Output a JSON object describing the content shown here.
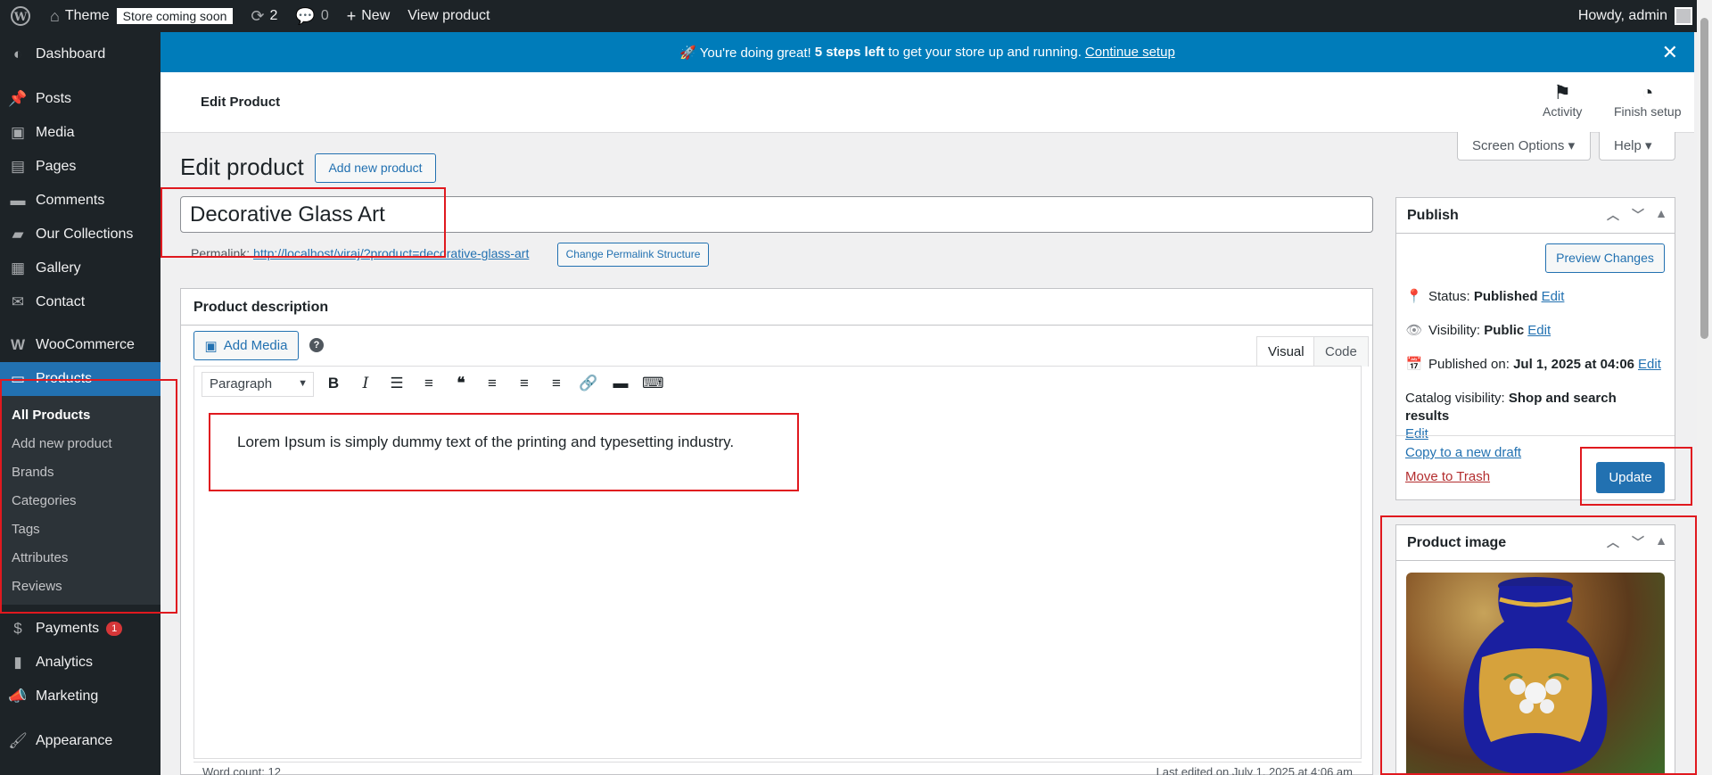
{
  "adminbar": {
    "site_name": "Theme",
    "store_badge": "Store coming soon",
    "updates_count": "2",
    "comments_count": "0",
    "new_label": "New",
    "view_product": "View product",
    "howdy": "Howdy, admin"
  },
  "sidebar": {
    "dashboard": "Dashboard",
    "posts": "Posts",
    "media": "Media",
    "pages": "Pages",
    "comments": "Comments",
    "collections": "Our Collections",
    "gallery": "Gallery",
    "contact": "Contact",
    "woocommerce": "WooCommerce",
    "products": "Products",
    "submenu": [
      "All Products",
      "Add new product",
      "Brands",
      "Categories",
      "Tags",
      "Attributes",
      "Reviews"
    ],
    "payments": "Payments",
    "payments_badge": "1",
    "analytics": "Analytics",
    "marketing": "Marketing",
    "appearance": "Appearance"
  },
  "notice": {
    "prefix": "🚀 You're doing great!",
    "bold": "5 steps left",
    "suffix": "to get your store up and running.",
    "link": "Continue setup"
  },
  "header": {
    "title": "Edit Product",
    "activity": "Activity",
    "finish_setup": "Finish setup",
    "screen_options": "Screen Options",
    "help": "Help"
  },
  "main": {
    "heading": "Edit product",
    "add_new": "Add new product",
    "title_value": "Decorative Glass Art",
    "permalink_label": "Permalink:",
    "permalink_url": "http://localhost/viraj/?product=decorative-glass-art",
    "change_permalink": "Change Permalink Structure"
  },
  "description": {
    "box_title": "Product description",
    "add_media": "Add Media",
    "tab_visual": "Visual",
    "tab_code": "Code",
    "format": "Paragraph",
    "content": "Lorem Ipsum is simply dummy text of the printing and typesetting industry.",
    "word_count": "Word count: 12",
    "last_edited": "Last edited on July 1, 2025 at 4:06 am"
  },
  "publish": {
    "title": "Publish",
    "preview": "Preview Changes",
    "status_label": "Status:",
    "status_value": "Published",
    "visibility_label": "Visibility:",
    "visibility_value": "Public",
    "published_label": "Published on:",
    "published_value": "Jul 1, 2025 at 04:06",
    "catalog_label": "Catalog visibility:",
    "catalog_value": "Shop and search results",
    "edit": "Edit",
    "copy_draft": "Copy to a new draft",
    "trash": "Move to Trash",
    "update": "Update"
  },
  "product_image": {
    "title": "Product image"
  }
}
